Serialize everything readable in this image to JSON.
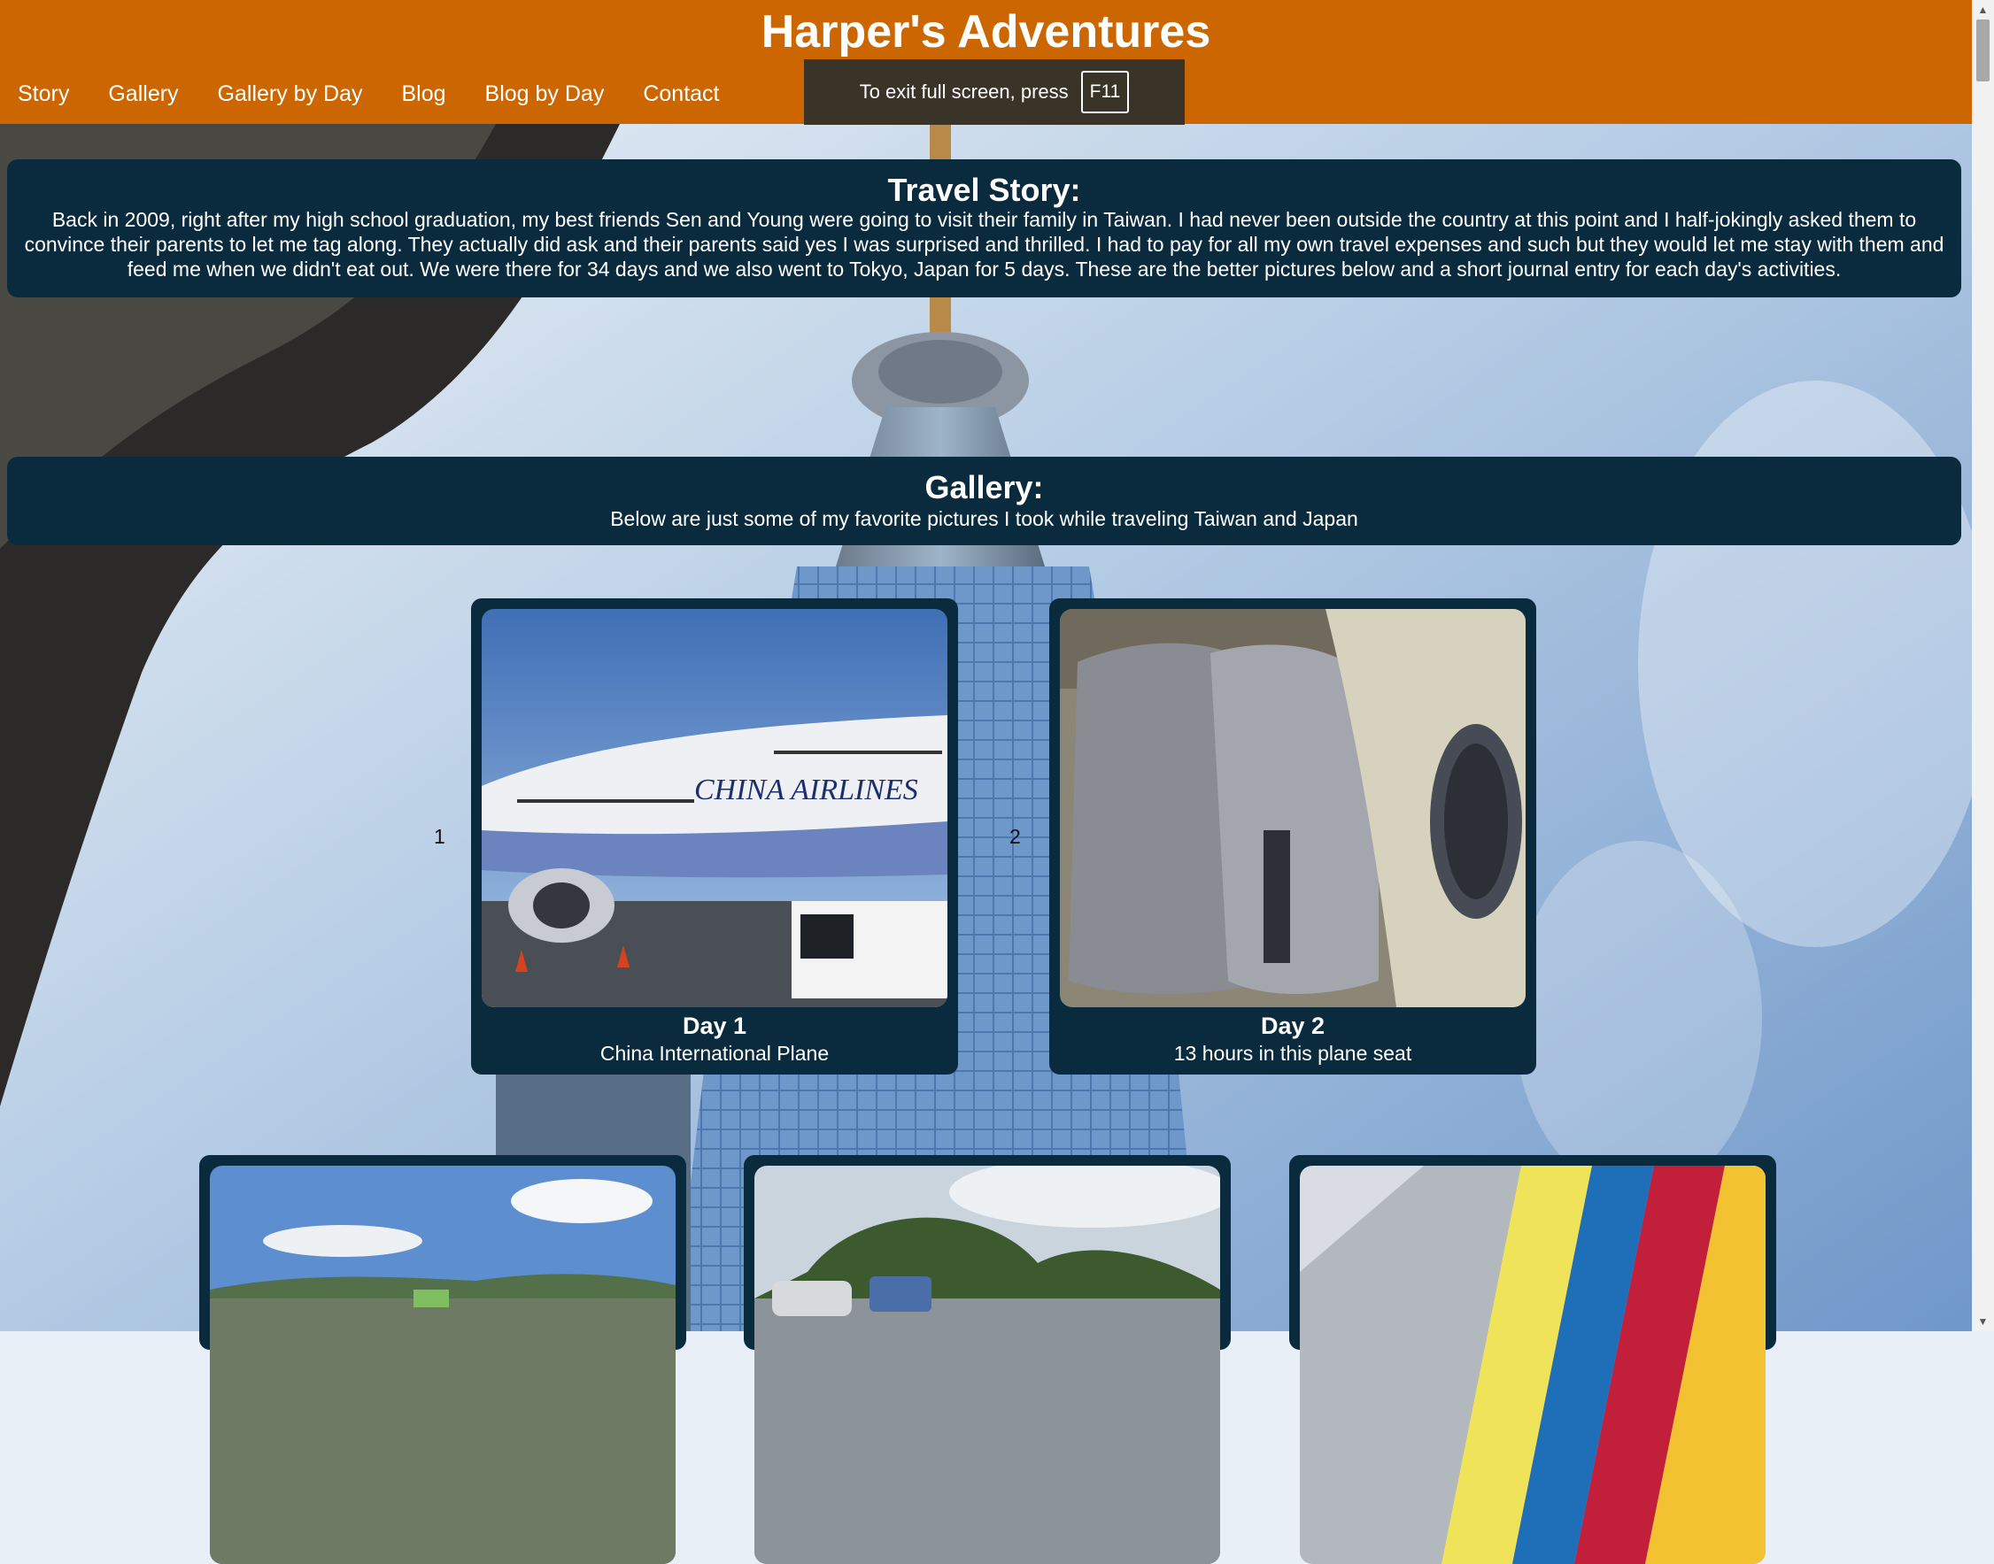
{
  "site": {
    "title": "Harper's Adventures"
  },
  "nav": {
    "items": [
      {
        "label": "Story"
      },
      {
        "label": "Gallery"
      },
      {
        "label": "Gallery by Day"
      },
      {
        "label": "Blog"
      },
      {
        "label": "Blog by Day"
      },
      {
        "label": "Contact"
      }
    ]
  },
  "fullscreen_toast": {
    "text": "To exit full screen, press",
    "key": "F11"
  },
  "story": {
    "heading": "Travel Story:",
    "text": "Back in 2009, right after my high school graduation, my best friends Sen and Young were going to visit their family in Taiwan. I had never been outside the country at this point and I half-jokingly asked them to convince their parents to let me tag along. They actually did ask and their parents said yes I was surprised and thrilled. I had to pay for all my own travel expenses and such but they would let me stay with them and feed me when we didn't eat out. We were there for 34 days and we also went to Tokyo, Japan for 5 days. These are the better pictures below and a short journal entry for each day's activities."
  },
  "gallery": {
    "heading": "Gallery:",
    "subtitle": "Below are just some of my favorite pictures I took while traveling Taiwan and Japan",
    "items": [
      {
        "number": "1",
        "day": "Day 1",
        "caption": "China International Plane",
        "photo_text": "CHINA AIRLINES"
      },
      {
        "number": "2",
        "day": "Day 2",
        "caption": "13 hours in this plane seat"
      }
    ]
  },
  "colors": {
    "header": "#cc6600",
    "panel": "#0a2b3e",
    "toast": "#3a3328"
  }
}
